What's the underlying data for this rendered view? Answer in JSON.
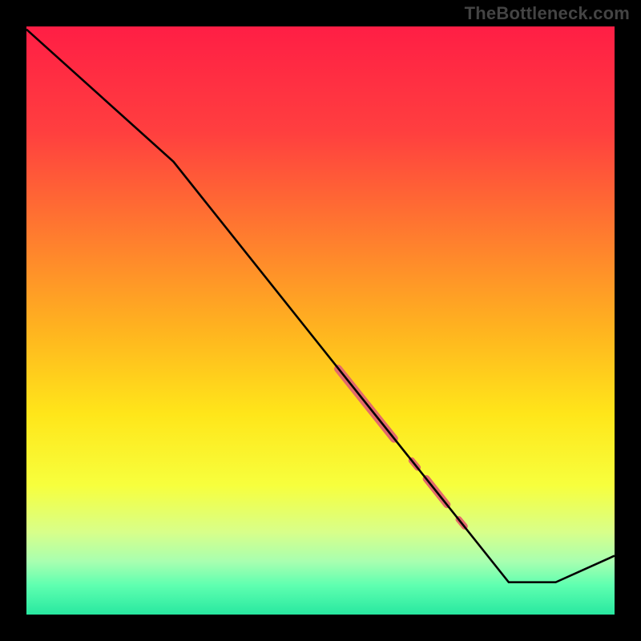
{
  "watermark": "TheBottleneck.com",
  "colors": {
    "gradient_stops": [
      {
        "offset": 0.0,
        "color": "#ff1e45"
      },
      {
        "offset": 0.18,
        "color": "#ff3f3f"
      },
      {
        "offset": 0.35,
        "color": "#ff7a2f"
      },
      {
        "offset": 0.52,
        "color": "#ffb51f"
      },
      {
        "offset": 0.66,
        "color": "#ffe61a"
      },
      {
        "offset": 0.78,
        "color": "#f7ff3d"
      },
      {
        "offset": 0.86,
        "color": "#d8ff8a"
      },
      {
        "offset": 0.91,
        "color": "#a8ffb0"
      },
      {
        "offset": 0.95,
        "color": "#5fffb0"
      },
      {
        "offset": 1.0,
        "color": "#28e8a0"
      }
    ],
    "curve": "#000000",
    "highlight": "#e26a6a"
  },
  "chart_data": {
    "type": "line",
    "title": "",
    "xlabel": "",
    "ylabel": "",
    "xlim": [
      0,
      100
    ],
    "ylim": [
      0,
      100
    ],
    "grid": false,
    "notes": "Bottleneck-percentage style curve on a red-to-green vertical gradient background. Data values are estimated from pixel positions; axes are unlabeled in the source image.",
    "series": [
      {
        "name": "curve",
        "x": [
          0.0,
          25.0,
          82.0,
          90.0,
          100.0
        ],
        "y": [
          99.5,
          77.0,
          5.5,
          5.5,
          10.0
        ]
      }
    ],
    "highlight_segments": [
      {
        "name": "segment-a",
        "x": [
          53.0,
          62.5
        ],
        "y": [
          41.8,
          29.9
        ],
        "weight": 10
      },
      {
        "name": "segment-b",
        "x": [
          65.5,
          66.5
        ],
        "y": [
          26.2,
          25.0
        ],
        "weight": 8
      },
      {
        "name": "segment-c",
        "x": [
          68.0,
          71.5
        ],
        "y": [
          23.1,
          18.7
        ],
        "weight": 9
      },
      {
        "name": "segment-d",
        "x": [
          73.5,
          74.5
        ],
        "y": [
          16.2,
          15.0
        ],
        "weight": 8
      }
    ]
  }
}
